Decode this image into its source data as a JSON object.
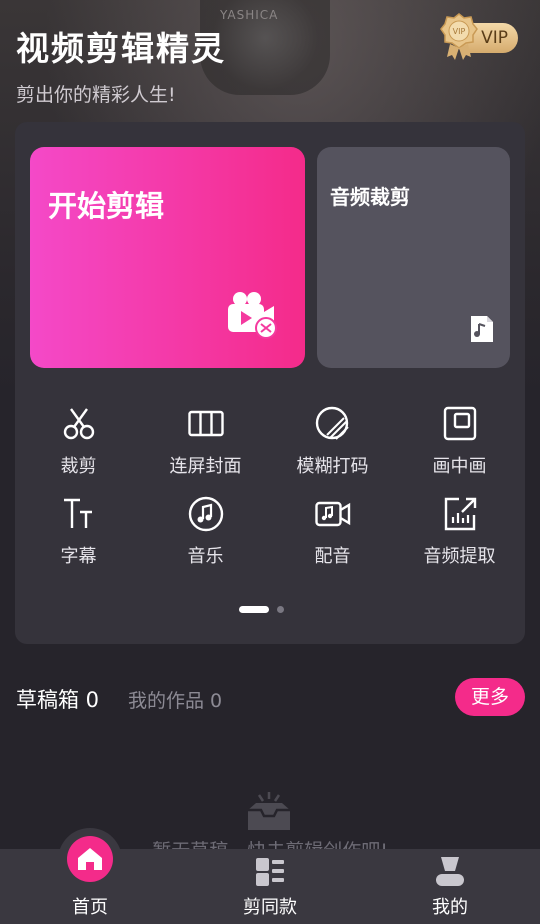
{
  "header": {
    "title": "视频剪辑精灵",
    "subtitle": "剪出你的精彩人生!",
    "camera_text": "YASHICA",
    "vip_label": "VIP",
    "vip_medal_text": "VIP"
  },
  "cards": {
    "start": {
      "label": "开始剪辑",
      "icon": "video-camera-scissors-icon"
    },
    "audio": {
      "label": "音频裁剪",
      "icon": "music-file-icon"
    }
  },
  "tools": [
    {
      "label": "裁剪",
      "icon": "scissors-icon"
    },
    {
      "label": "连屏封面",
      "icon": "grid-columns-icon"
    },
    {
      "label": "模糊打码",
      "icon": "blur-circle-icon"
    },
    {
      "label": "画中画",
      "icon": "picture-in-picture-icon"
    },
    {
      "label": "字幕",
      "icon": "text-subtitle-icon"
    },
    {
      "label": "音乐",
      "icon": "music-note-icon"
    },
    {
      "label": "配音",
      "icon": "video-dub-icon"
    },
    {
      "label": "音频提取",
      "icon": "audio-extract-icon"
    }
  ],
  "pager": {
    "pages": 2,
    "current": 1
  },
  "drafts": {
    "drafts_tab": "草稿箱 0",
    "works_tab": "我的作品 0",
    "more_button": "更多",
    "empty_text": "暂无草稿，快去剪辑创作吧!"
  },
  "bottom_nav": [
    {
      "label": "首页",
      "icon": "home-icon",
      "active": true
    },
    {
      "label": "剪同款",
      "icon": "template-list-icon",
      "active": false
    },
    {
      "label": "我的",
      "icon": "user-profile-icon",
      "active": false
    }
  ],
  "colors": {
    "accent": "#f42b8a",
    "start_gradient_from": "#f449c8",
    "audio_card": "#55535e",
    "panel": "#35333b",
    "background": "#26242b"
  }
}
